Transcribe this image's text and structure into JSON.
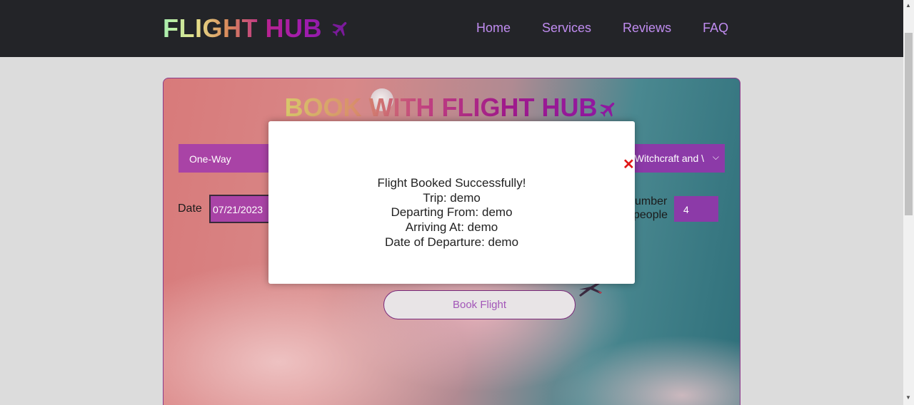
{
  "header": {
    "logo_text": "FLIGHT HUB",
    "logo_icon": "airplane-icon",
    "nav": [
      {
        "label": "Home"
      },
      {
        "label": "Services"
      },
      {
        "label": "Reviews"
      },
      {
        "label": "FAQ"
      }
    ]
  },
  "booking": {
    "title_text": "BOOK WITH FLIGHT HUB",
    "title_icon": "airplane-icon",
    "trip_type_value": "One-Way",
    "destination_value": "f Witchcraft and \\",
    "date_label": "Date",
    "date_value": "07/21/2023",
    "people_label_line1": "umber",
    "people_label_line2": "people",
    "people_value": "4",
    "book_button_label": "Book Flight"
  },
  "modal": {
    "close_symbol": "✕",
    "lines": [
      "Flight Booked Successfully!",
      "Trip: demo",
      "Departing From: demo",
      "Arriving At: demo",
      "Date of Departure: demo"
    ]
  },
  "colors": {
    "header_bg": "#232428",
    "nav_link": "#c08cf0",
    "input_bg": "#a943a6",
    "close_red": "#e01818"
  }
}
